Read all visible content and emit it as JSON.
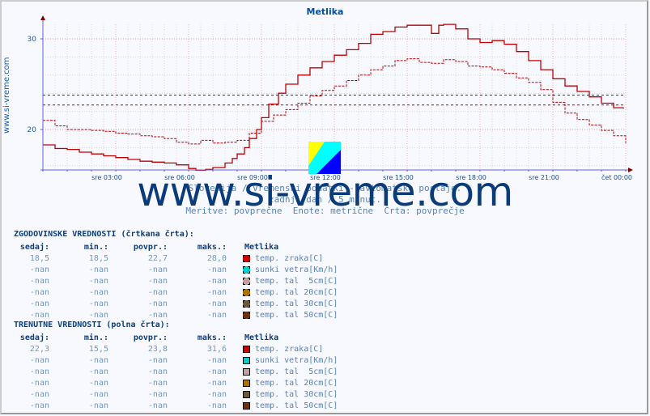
{
  "page": {
    "side_label": "www.si-vreme.com",
    "watermark": "www.si-vreme.com",
    "subtitle_lines": [
      "Slovenija / vremenski podatki - avtomatske postaje.",
      "zadnji dan / 5 minut.",
      "Meritve: povprečne  Enote: metrične  Črta: povprečje"
    ]
  },
  "chart_data": {
    "type": "line",
    "title": "Metlika",
    "xlabel": "",
    "ylabel": "",
    "x_range_hours": [
      0,
      24
    ],
    "ylim": [
      15.5,
      31.8
    ],
    "grid": true,
    "x_tick_labels": [
      {
        "h": 3,
        "label": "sre 03:00"
      },
      {
        "h": 6,
        "label": "sre 06:00"
      },
      {
        "h": 9,
        "label": "sre 09:00"
      },
      {
        "h": 12,
        "label": "sre 12:00"
      },
      {
        "h": 15,
        "label": "sre 15:00"
      },
      {
        "h": 18,
        "label": "sre 18:00"
      },
      {
        "h": 21,
        "label": "sre 21:00"
      },
      {
        "h": 24,
        "label": "čet 00:00"
      }
    ],
    "y_tick_labels": [
      20,
      30
    ],
    "reference_lines": [
      {
        "name": "avg-current",
        "value": 23.8
      },
      {
        "name": "avg-historical",
        "value": 22.7
      }
    ],
    "series": [
      {
        "name": "temp. zraka [C] (trenutne)",
        "style": "solid",
        "color": "#c00000",
        "x_hours": [
          0,
          0.5,
          1,
          1.5,
          2,
          2.5,
          3,
          3.5,
          4,
          4.5,
          5,
          5.5,
          6,
          6.3,
          6.7,
          7,
          7.5,
          7.8,
          8,
          8.3,
          8.5,
          8.8,
          9,
          9.3,
          9.7,
          10,
          10.5,
          11,
          11.5,
          12,
          12.5,
          13,
          13.5,
          14,
          14.5,
          15,
          15.5,
          16,
          16.3,
          16.5,
          17,
          17.5,
          18,
          18.5,
          19,
          19.5,
          20,
          20.5,
          21,
          21.5,
          22,
          22.5,
          23,
          23.5,
          23.9
        ],
        "values": [
          18.3,
          17.9,
          17.8,
          17.5,
          17.3,
          17.1,
          16.9,
          16.7,
          16.5,
          16.4,
          16.3,
          16.1,
          15.7,
          15.5,
          15.6,
          15.8,
          16.3,
          16.8,
          17.3,
          18.0,
          19.0,
          20.0,
          21.3,
          22.8,
          24.0,
          25.0,
          26.0,
          26.8,
          27.5,
          28.2,
          28.8,
          29.5,
          30.5,
          30.8,
          31.3,
          31.5,
          31.5,
          30.6,
          31.5,
          31.6,
          31.1,
          30.0,
          29.6,
          29.8,
          29.4,
          28.6,
          27.6,
          26.6,
          25.6,
          24.8,
          24.2,
          23.6,
          22.9,
          22.4,
          22.3
        ]
      },
      {
        "name": "temp. zraka [C] (zgodovinske)",
        "style": "dashed",
        "color": "#c00000",
        "x_hours": [
          0,
          0.5,
          1,
          1.5,
          2,
          2.5,
          3,
          3.5,
          4,
          4.5,
          5,
          5.5,
          6,
          6.5,
          7,
          7.5,
          8,
          8.5,
          9,
          9.5,
          10,
          10.5,
          11,
          11.5,
          12,
          12.5,
          13,
          13.5,
          14,
          14.5,
          15,
          15.5,
          16,
          16.5,
          17,
          17.5,
          18,
          18.5,
          19,
          19.5,
          20,
          20.5,
          21,
          21.5,
          22,
          22.5,
          23,
          23.5,
          24
        ],
        "values": [
          21.0,
          20.4,
          20.0,
          20.0,
          19.9,
          19.8,
          19.6,
          19.5,
          19.3,
          19.2,
          19.0,
          18.6,
          18.4,
          18.8,
          18.5,
          18.6,
          18.8,
          19.6,
          20.9,
          21.6,
          22.2,
          22.9,
          23.7,
          24.3,
          24.8,
          25.4,
          26.0,
          26.6,
          27.0,
          27.6,
          27.8,
          27.4,
          27.3,
          27.7,
          27.5,
          27.0,
          26.9,
          26.6,
          26.2,
          25.7,
          25.2,
          24.4,
          23.0,
          21.8,
          21.1,
          20.5,
          19.9,
          19.3,
          18.5
        ]
      }
    ]
  },
  "tables": [
    {
      "heading": "ZGODOVINSKE VREDNOSTI (črtkana črta):",
      "kind": "hist",
      "headers": [
        "sedaj:",
        "min.:",
        "povpr.:",
        "maks.:"
      ],
      "location": "Metlika",
      "rows": [
        {
          "values": [
            "18,5",
            "18,5",
            "22,7",
            "28,0"
          ],
          "label": "temp. zraka[C]",
          "color": "#cc0000"
        },
        {
          "values": [
            "-nan",
            "-nan",
            "-nan",
            "-nan"
          ],
          "label": "sunki vetra[Km/h]",
          "color": "#00cccc"
        },
        {
          "values": [
            "-nan",
            "-nan",
            "-nan",
            "-nan"
          ],
          "label": "temp. tal  5cm[C]",
          "color": "#c0a0a0"
        },
        {
          "values": [
            "-nan",
            "-nan",
            "-nan",
            "-nan"
          ],
          "label": "temp. tal 20cm[C]",
          "color": "#b07000"
        },
        {
          "values": [
            "-nan",
            "-nan",
            "-nan",
            "-nan"
          ],
          "label": "temp. tal 30cm[C]",
          "color": "#6a5a3a"
        },
        {
          "values": [
            "-nan",
            "-nan",
            "-nan",
            "-nan"
          ],
          "label": "temp. tal 50cm[C]",
          "color": "#703010"
        }
      ]
    },
    {
      "heading": "TRENUTNE VREDNOSTI (polna črta):",
      "kind": "curr",
      "headers": [
        "sedaj:",
        "min.:",
        "povpr.:",
        "maks.:"
      ],
      "location": "Metlika",
      "rows": [
        {
          "values": [
            "22,3",
            "15,5",
            "23,8",
            "31,6"
          ],
          "label": "temp. zraka[C]",
          "color": "#cc0000"
        },
        {
          "values": [
            "-nan",
            "-nan",
            "-nan",
            "-nan"
          ],
          "label": "sunki vetra[Km/h]",
          "color": "#00cccc"
        },
        {
          "values": [
            "-nan",
            "-nan",
            "-nan",
            "-nan"
          ],
          "label": "temp. tal  5cm[C]",
          "color": "#c0a0a0"
        },
        {
          "values": [
            "-nan",
            "-nan",
            "-nan",
            "-nan"
          ],
          "label": "temp. tal 20cm[C]",
          "color": "#b07000"
        },
        {
          "values": [
            "-nan",
            "-nan",
            "-nan",
            "-nan"
          ],
          "label": "temp. tal 30cm[C]",
          "color": "#6a5a3a"
        },
        {
          "values": [
            "-nan",
            "-nan",
            "-nan",
            "-nan"
          ],
          "label": "temp. tal 50cm[C]",
          "color": "#703010"
        }
      ]
    }
  ]
}
